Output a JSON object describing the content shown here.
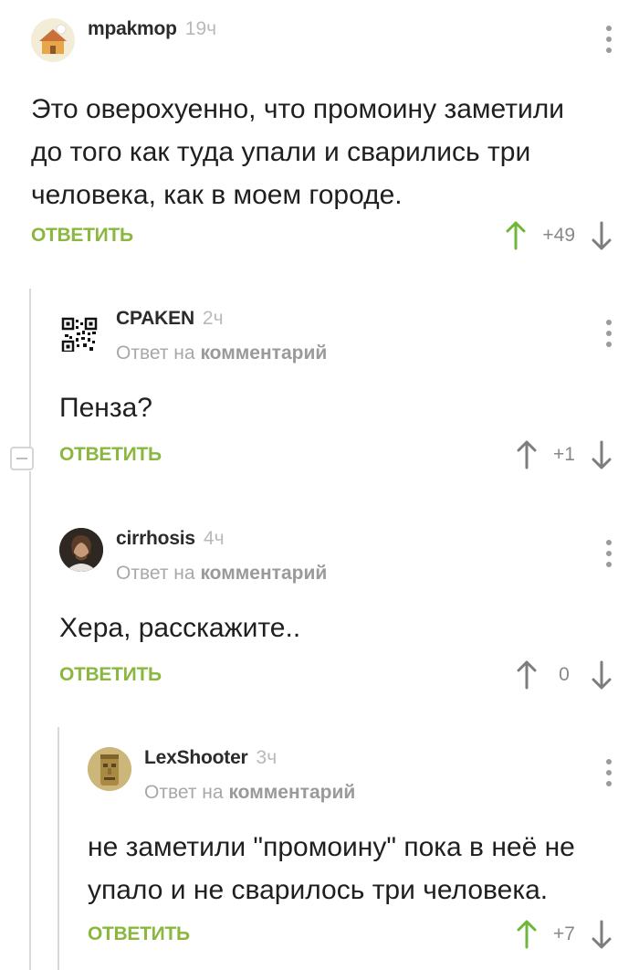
{
  "colors": {
    "accent_green": "#8ab83f",
    "upvoted_green": "#6fb738",
    "muted": "#a8a8a8"
  },
  "comments": [
    {
      "author": "mpakmop",
      "time": "19ч",
      "reply_prefix": "",
      "reply_target": "",
      "text_lines": [
        "Это оверохуенно, что промоину заметили",
        "до того как туда упали и сварились три",
        "человека, как в моем городе."
      ],
      "reply_label": "ОТВЕТИТЬ",
      "rating": "+49",
      "upvoted": true,
      "avatar_icon": "house-avatar"
    },
    {
      "author": "CPAKEN",
      "time": "2ч",
      "reply_prefix": "Ответ на",
      "reply_target": "комментарий",
      "text_lines": [
        "Пенза?"
      ],
      "reply_label": "ОТВЕТИТЬ",
      "rating": "+1",
      "upvoted": false,
      "avatar_icon": "qr-code-avatar"
    },
    {
      "author": "cirrhosis",
      "time": "4ч",
      "reply_prefix": "Ответ на",
      "reply_target": "комментарий",
      "text_lines": [
        "Хера, расскажите.."
      ],
      "reply_label": "ОТВЕТИТЬ",
      "rating": "0",
      "upvoted": false,
      "avatar_icon": "person-photo-avatar"
    },
    {
      "author": "LexShooter",
      "time": "3ч",
      "reply_prefix": "Ответ на",
      "reply_target": "комментарий",
      "text_lines": [
        "не заметили \"промоину\" пока в неё не",
        "упало и не сварилось три человека."
      ],
      "reply_label": "ОТВЕТИТЬ",
      "rating": "+7",
      "upvoted": true,
      "avatar_icon": "stone-statue-avatar"
    }
  ]
}
